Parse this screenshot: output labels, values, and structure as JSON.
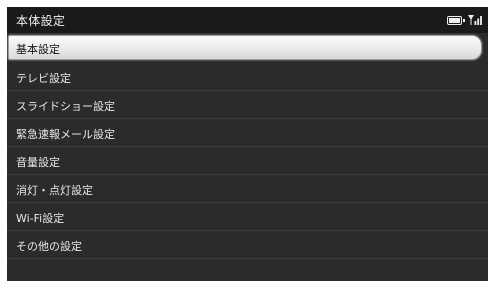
{
  "header": {
    "title": "本体設定",
    "battery_icon": "battery-icon",
    "signal_icon": "signal-icon"
  },
  "menu": {
    "items": [
      {
        "label": "基本設定",
        "selected": true
      },
      {
        "label": "テレビ設定",
        "selected": false
      },
      {
        "label": "スライドショー設定",
        "selected": false
      },
      {
        "label": "緊急速報メール設定",
        "selected": false
      },
      {
        "label": "音量設定",
        "selected": false
      },
      {
        "label": "消灯・点灯設定",
        "selected": false
      },
      {
        "label": "Wi-Fi設定",
        "selected": false
      },
      {
        "label": "その他の設定",
        "selected": false
      }
    ]
  },
  "colors": {
    "background": "#2b2b2b",
    "titlebar": "#1a1a1a",
    "text": "#e8e8e8",
    "selected_text": "#111111"
  }
}
